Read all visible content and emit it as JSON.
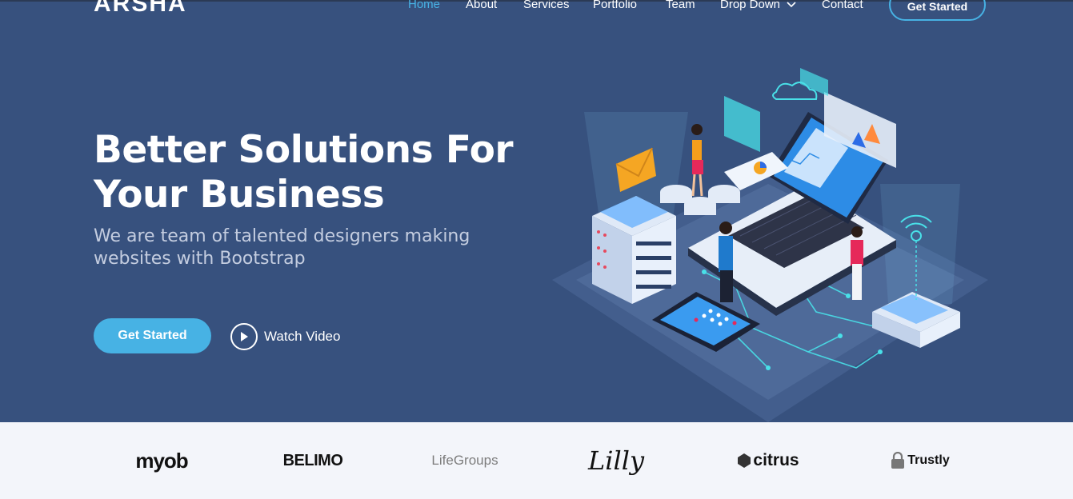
{
  "brand": {
    "logo_text": "ARSHA"
  },
  "nav": {
    "items": [
      {
        "label": "Home",
        "active": true
      },
      {
        "label": "About"
      },
      {
        "label": "Services"
      },
      {
        "label": "Portfolio"
      },
      {
        "label": "Team"
      },
      {
        "label": "Drop Down",
        "has_dropdown": true
      },
      {
        "label": "Contact"
      }
    ],
    "cta_label": "Get Started"
  },
  "hero": {
    "title_line1": "Better Solutions For",
    "title_line2": "Your Business",
    "subtitle": "We are team of talented designers making websites with Bootstrap",
    "primary_button": "Get Started",
    "video_link": "Watch Video",
    "illustration_icon": "laptop-servers-isometric-illustration"
  },
  "clients": {
    "logos": [
      {
        "name": "myob"
      },
      {
        "name": "BELIMO"
      },
      {
        "name": "LifeGroups"
      },
      {
        "name": "Lilly"
      },
      {
        "name": "citrus"
      },
      {
        "name": "Trustly"
      }
    ]
  },
  "colors": {
    "hero_bg": "#37517e",
    "accent": "#47b2e4",
    "clients_bg": "#f3f5fa"
  }
}
